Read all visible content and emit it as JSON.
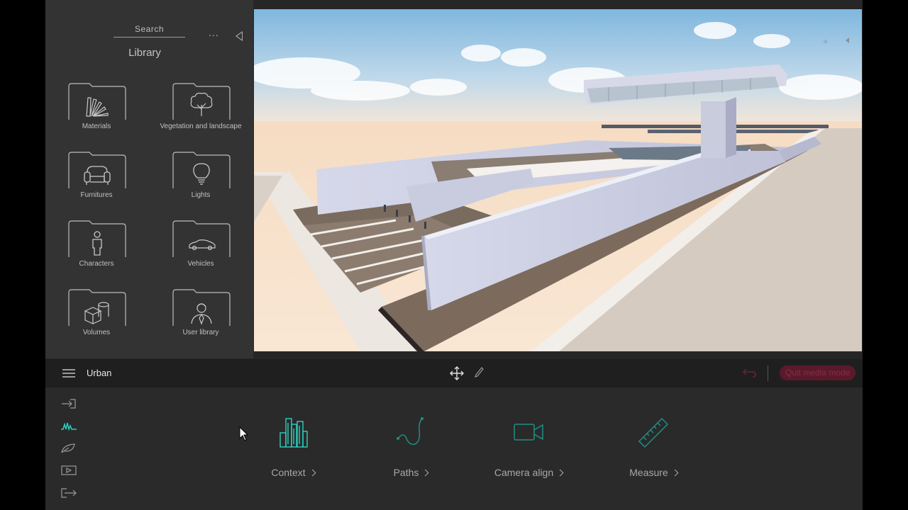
{
  "library": {
    "search_label": "Search",
    "more_label": "...",
    "title": "Library",
    "categories": [
      {
        "label": "Materials",
        "icon": "materials-swatch-icon"
      },
      {
        "label": "Vegetation and landscape",
        "icon": "tree-icon"
      },
      {
        "label": "Furnitures",
        "icon": "armchair-icon"
      },
      {
        "label": "Lights",
        "icon": "lightbulb-icon"
      },
      {
        "label": "Characters",
        "icon": "person-icon"
      },
      {
        "label": "Vehicles",
        "icon": "car-icon"
      },
      {
        "label": "Volumes",
        "icon": "cube-cylinder-icon"
      },
      {
        "label": "User library",
        "icon": "user-icon"
      }
    ]
  },
  "toolbar": {
    "mode_label": "Urban",
    "quit_media_label": "Quit media mode"
  },
  "bottom": {
    "side_tabs": [
      "import-icon",
      "waveform-icon",
      "leaf-icon",
      "media-icon",
      "export-icon"
    ],
    "active_side_tab": 1,
    "tools": [
      {
        "label": "Context",
        "icon": "city-buildings-icon"
      },
      {
        "label": "Paths",
        "icon": "path-curve-icon"
      },
      {
        "label": "Camera align",
        "icon": "video-camera-icon"
      },
      {
        "label": "Measure",
        "icon": "ruler-icon"
      }
    ]
  },
  "colors": {
    "accent": "#2ad1c0",
    "accent_dim": "#1f8f84",
    "quit_button_bg": "#5a1a2c",
    "panel_bg": "#333334"
  }
}
